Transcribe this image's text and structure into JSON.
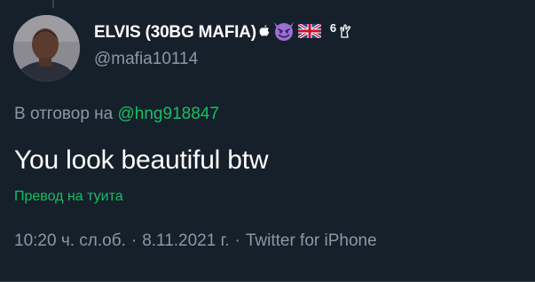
{
  "author": {
    "display_name": "ELVIS (30BG MAFIA)",
    "superscript": "6",
    "handle": "@mafia10114",
    "badges": [
      "apple-icon",
      "smiling-devil-emoji-icon",
      "uk-flag-icon",
      "fingers-crossed-emoji-icon"
    ]
  },
  "reply": {
    "prefix": "В отговор на ",
    "target_handle": "@hng918847"
  },
  "tweet": {
    "text": "You look beautiful btw",
    "translate_label": "Превод на туита"
  },
  "meta": {
    "time": "10:20 ч. сл.об.",
    "separator": "·",
    "date": "8.11.2021 г.",
    "source": "Twitter for iPhone"
  },
  "colors": {
    "background": "#15202b",
    "primary_text": "#ffffff",
    "secondary_text": "#8899a6",
    "link_green": "#17bf63",
    "divider": "#38444d"
  }
}
